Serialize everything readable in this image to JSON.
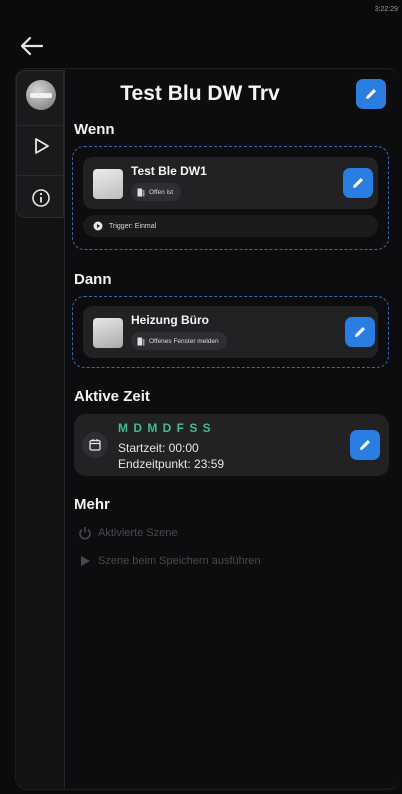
{
  "status": {
    "time": "3:22:29"
  },
  "nav": {
    "back_icon": "arrow-left-icon"
  },
  "side_tabs": [
    {
      "icon": "device-avatar-icon"
    },
    {
      "icon": "play-icon"
    },
    {
      "icon": "info-icon"
    }
  ],
  "header": {
    "title": "Test Blu DW Trv",
    "edit_icon": "pencil-icon"
  },
  "wenn": {
    "label": "Wenn",
    "device_name": "Test Ble DW1",
    "state": "Offen ist",
    "trigger": "Trigger: Einmal"
  },
  "dann": {
    "label": "Dann",
    "device_name": "Heizung Büro",
    "action": "Offenes Fenster melden"
  },
  "active_time": {
    "label": "Aktive Zeit",
    "days": "M D M D F S S",
    "start": "Startzeit: 00:00",
    "end": "Endzeitpunkt: 23:59"
  },
  "more": {
    "label": "Mehr",
    "items": [
      "Aktivierte Szene",
      "Szene beim Speichern ausführen"
    ]
  },
  "colors": {
    "accent": "#2a7de1",
    "days_green": "#3fbf8a",
    "dashed_border": "#3b67b5"
  }
}
